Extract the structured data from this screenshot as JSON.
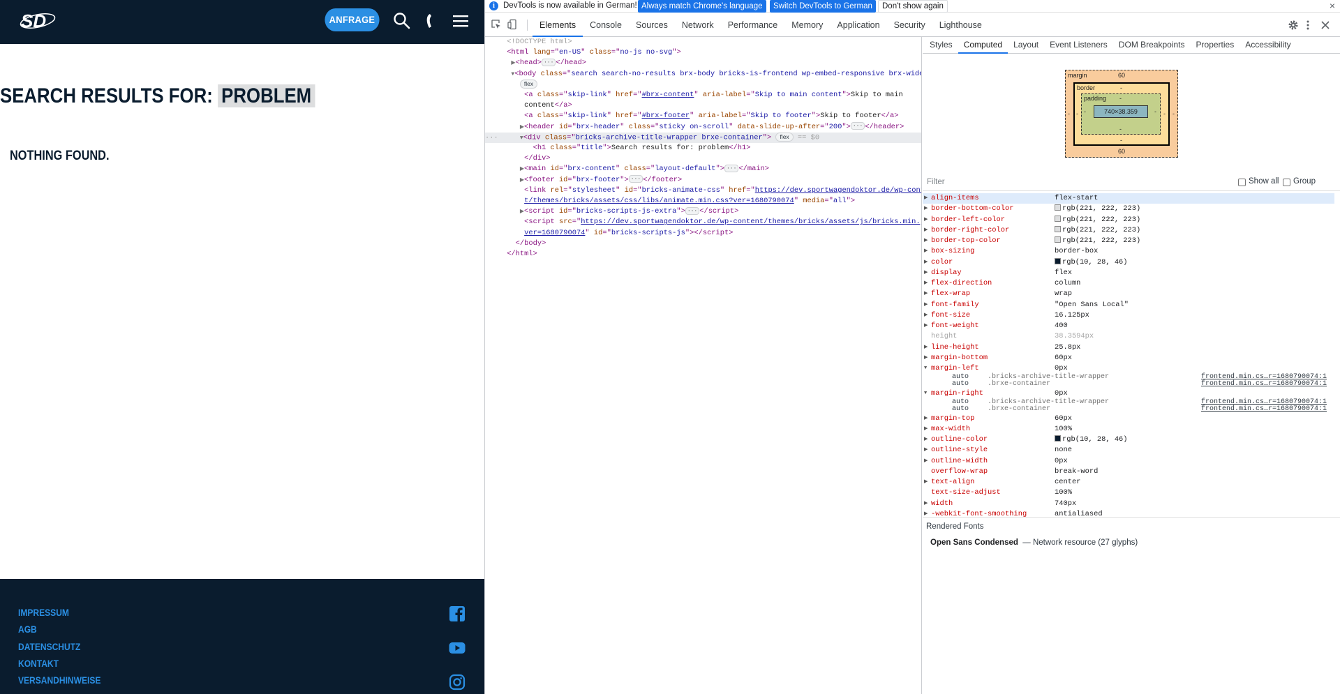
{
  "site": {
    "header": {
      "logo_text": "SD",
      "cta_label": "ANFRAGE",
      "icons": [
        "search-icon",
        "phone-icon",
        "menu-icon"
      ]
    },
    "title_prefix": "SEARCH RESULTS FOR: ",
    "search_term": "PROBLEM",
    "nothing_found": "NOTHING FOUND.",
    "footer": {
      "links": [
        "IMPRESSUM",
        "AGB",
        "DATENSCHUTZ",
        "KONTAKT",
        "VERSANDHINWEISE"
      ],
      "social_icons": [
        "facebook-icon",
        "youtube-icon",
        "instagram-icon"
      ]
    },
    "colors": {
      "dark": "#0a1c2e",
      "accent": "#2b8fe3",
      "highlight": "#dddedf"
    }
  },
  "devtools": {
    "infobar": {
      "text": "DevTools is now available in German!",
      "btn_match": "Always match Chrome's language",
      "btn_switch": "Switch DevTools to German",
      "btn_dismiss": "Don't show again",
      "close": "×"
    },
    "tabs": [
      "Elements",
      "Console",
      "Sources",
      "Network",
      "Performance",
      "Memory",
      "Application",
      "Security",
      "Lighthouse"
    ],
    "active_tab": "Elements",
    "side_tabs": [
      "Styles",
      "Computed",
      "Layout",
      "Event Listeners",
      "DOM Breakpoints",
      "Properties",
      "Accessibility"
    ],
    "active_side_tab": "Computed",
    "box_model": {
      "margin_label": "margin",
      "margin_top": "60",
      "margin_bottom": "60",
      "margin_left": "-",
      "margin_right": "-",
      "border_label": "border",
      "border_top": "-",
      "border_bottom": "-",
      "border_left": "-",
      "border_right": "-",
      "padding_label": "padding",
      "padding_top": "-",
      "padding_bottom": "-",
      "padding_left": "-",
      "padding_right": "-",
      "content": "740×38.359"
    },
    "filter_placeholder": "Filter",
    "show_all": "Show all",
    "group": "Group",
    "computed": [
      {
        "name": "align-items",
        "value": "flex-start"
      },
      {
        "name": "border-bottom-color",
        "value": "rgb(221, 222, 223)",
        "swatch": "#dddedf"
      },
      {
        "name": "border-left-color",
        "value": "rgb(221, 222, 223)",
        "swatch": "#dddedf"
      },
      {
        "name": "border-right-color",
        "value": "rgb(221, 222, 223)",
        "swatch": "#dddedf"
      },
      {
        "name": "border-top-color",
        "value": "rgb(221, 222, 223)",
        "swatch": "#dddedf"
      },
      {
        "name": "box-sizing",
        "value": "border-box"
      },
      {
        "name": "color",
        "value": "rgb(10, 28, 46)",
        "swatch": "#0a1c2e"
      },
      {
        "name": "display",
        "value": "flex"
      },
      {
        "name": "flex-direction",
        "value": "column"
      },
      {
        "name": "flex-wrap",
        "value": "wrap"
      },
      {
        "name": "font-family",
        "value": "\"Open Sans Local\""
      },
      {
        "name": "font-size",
        "value": "16.125px"
      },
      {
        "name": "font-weight",
        "value": "400"
      },
      {
        "name": "height",
        "value": "38.3594px"
      },
      {
        "name": "line-height",
        "value": "25.8px"
      },
      {
        "name": "margin-bottom",
        "value": "60px"
      },
      {
        "name": "margin-left",
        "value": "0px"
      },
      {
        "name": "margin-right",
        "value": "0px"
      },
      {
        "name": "margin-top",
        "value": "60px"
      },
      {
        "name": "max-width",
        "value": "100%"
      },
      {
        "name": "outline-color",
        "value": "rgb(10, 28, 46)",
        "swatch": "#0a1c2e"
      },
      {
        "name": "outline-style",
        "value": "none"
      },
      {
        "name": "outline-width",
        "value": "0px"
      },
      {
        "name": "overflow-wrap",
        "value": "break-word"
      },
      {
        "name": "text-align",
        "value": "center"
      },
      {
        "name": "text-size-adjust",
        "value": "100%"
      },
      {
        "name": "width",
        "value": "740px"
      },
      {
        "name": "-webkit-font-smoothing",
        "value": "antialiased"
      }
    ],
    "margin_sources": {
      "val": "auto",
      "sel1": ".bricks-archive-title-wrapper",
      "sel2": ".brxe-container",
      "src": "frontend.min.cs…r=1680790074:1"
    },
    "rendered_fonts_title": "Rendered Fonts",
    "rendered_font_name": "Open Sans Condensed",
    "rendered_font_info": "— Network resource (27 glyphs)",
    "dom": {
      "doctype": "<!DOCTYPE html>",
      "html_lang": "en-US",
      "html_class": "no-js no-svg",
      "body_class": "search search-no-results brx-body bricks-is-frontend wp-embed-responsive brx-wide",
      "flex_badge": "flex",
      "skip1_href": "#brx-content",
      "skip1_label": "Skip to main content",
      "skip1_text_a": "Skip to main",
      "skip1_text_b": "content",
      "skip2_href": "#brx-footer",
      "skip2_label": "Skip to footer",
      "skip2_text": "Skip to footer",
      "header_id": "brx-header",
      "header_class": "sticky on-scroll",
      "header_slide": "200",
      "div_class": "bricks-archive-title-wrapper brxe-container",
      "dollar0": "== $0",
      "h1_class": "title",
      "h1_text": "Search results for: problem",
      "main_id": "brx-content",
      "main_class": "layout-default",
      "footer_id": "brx-footer",
      "link_id": "bricks-animate-css",
      "link_href_a": "https://dev.sportwagendoktor.de/wp-conten",
      "link_href_b": "t/themes/bricks/assets/css/libs/animate.min.css?ver=1680790074",
      "link_media": "all",
      "script_id": "bricks-scripts-js-extra",
      "script2_src_a": "https://dev.sportwagendoktor.de/wp-content/themes/bricks/assets/js/bricks.min.js?",
      "script2_src_b": "ver=1680790074",
      "script2_id": "bricks-scripts-js"
    }
  }
}
